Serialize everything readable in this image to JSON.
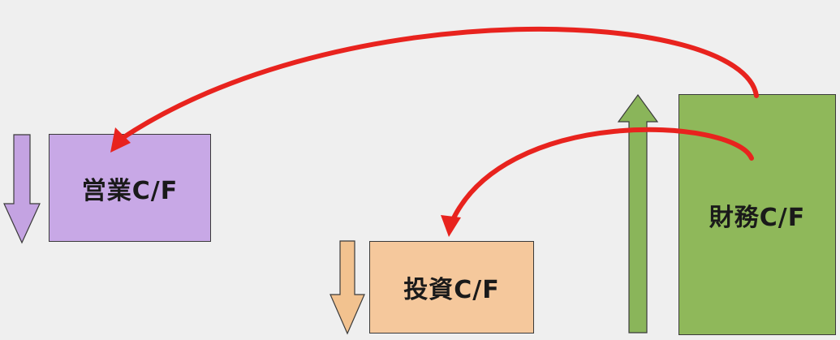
{
  "colors": {
    "background": "#efefef",
    "operating_fill": "#c8a8e6",
    "investing_fill": "#f5c89c",
    "financing_fill": "#8fb85a",
    "operating_arrow": "#c4a3e2",
    "investing_arrow": "#f2c28f",
    "financing_arrow": "#8ab55a",
    "flow_arrow": "#e8231e",
    "outline": "#3a3a3a"
  },
  "boxes": {
    "operating": {
      "label": "営業C/F",
      "direction": "down"
    },
    "investing": {
      "label": "投資C/F",
      "direction": "down"
    },
    "financing": {
      "label": "財務C/F",
      "direction": "up"
    }
  },
  "flows": [
    {
      "from": "financing",
      "to": "operating"
    },
    {
      "from": "financing",
      "to": "investing"
    }
  ]
}
